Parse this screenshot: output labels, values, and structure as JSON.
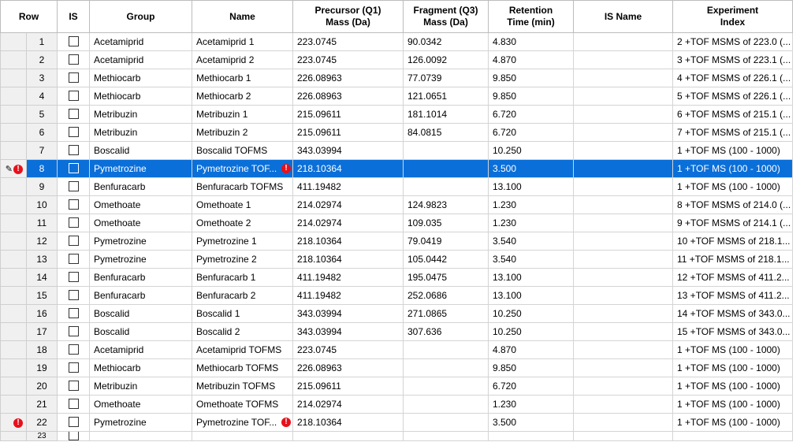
{
  "columns": {
    "row": "Row",
    "is": "IS",
    "group": "Group",
    "name": "Name",
    "precursor_l1": "Precursor (Q1)",
    "precursor_l2": "Mass (Da)",
    "fragment_l1": "Fragment (Q3)",
    "fragment_l2": "Mass (Da)",
    "retention_l1": "Retention",
    "retention_l2": "Time (min)",
    "is_name": "IS Name",
    "experiment_l1": "Experiment",
    "experiment_l2": "Index"
  },
  "rows": [
    {
      "row": "1",
      "group": "Acetamiprid",
      "name": "Acetamiprid 1",
      "precursor": "223.0745",
      "fragment": "90.0342",
      "retention": "4.830",
      "is_name": "",
      "experiment": "2 +TOF MSMS of 223.0 (..."
    },
    {
      "row": "2",
      "group": "Acetamiprid",
      "name": "Acetamiprid 2",
      "precursor": "223.0745",
      "fragment": "126.0092",
      "retention": "4.870",
      "is_name": "",
      "experiment": "3 +TOF MSMS of 223.1 (..."
    },
    {
      "row": "3",
      "group": "Methiocarb",
      "name": "Methiocarb 1",
      "precursor": "226.08963",
      "fragment": "77.0739",
      "retention": "9.850",
      "is_name": "",
      "experiment": "4 +TOF MSMS of 226.1 (..."
    },
    {
      "row": "4",
      "group": "Methiocarb",
      "name": "Methiocarb 2",
      "precursor": "226.08963",
      "fragment": "121.0651",
      "retention": "9.850",
      "is_name": "",
      "experiment": "5 +TOF MSMS of 226.1 (..."
    },
    {
      "row": "5",
      "group": "Metribuzin",
      "name": "Metribuzin 1",
      "precursor": "215.09611",
      "fragment": "181.1014",
      "retention": "6.720",
      "is_name": "",
      "experiment": "6 +TOF MSMS of 215.1 (..."
    },
    {
      "row": "6",
      "group": "Metribuzin",
      "name": "Metribuzin 2",
      "precursor": "215.09611",
      "fragment": "84.0815",
      "retention": "6.720",
      "is_name": "",
      "experiment": "7 +TOF MSMS of 215.1 (..."
    },
    {
      "row": "7",
      "group": "Boscalid",
      "name": "Boscalid TOFMS",
      "precursor": "343.03994",
      "fragment": "",
      "retention": "10.250",
      "is_name": "",
      "experiment": "1 +TOF MS (100 - 1000)"
    },
    {
      "row": "8",
      "group": "Pymetrozine",
      "name": "Pymetrozine  TOF...",
      "precursor": "218.10364",
      "fragment": "",
      "retention": "3.500",
      "is_name": "",
      "experiment": "1 +TOF MS (100 - 1000)"
    },
    {
      "row": "9",
      "group": "Benfuracarb",
      "name": "Benfuracarb TOFMS",
      "precursor": "411.19482",
      "fragment": "",
      "retention": "13.100",
      "is_name": "",
      "experiment": "1 +TOF MS (100 - 1000)"
    },
    {
      "row": "10",
      "group": "Omethoate",
      "name": "Omethoate 1",
      "precursor": "214.02974",
      "fragment": "124.9823",
      "retention": "1.230",
      "is_name": "",
      "experiment": "8 +TOF MSMS of 214.0 (..."
    },
    {
      "row": "11",
      "group": "Omethoate",
      "name": "Omethoate 2",
      "precursor": "214.02974",
      "fragment": "109.035",
      "retention": "1.230",
      "is_name": "",
      "experiment": "9 +TOF MSMS of 214.1 (..."
    },
    {
      "row": "12",
      "group": "Pymetrozine",
      "name": "Pymetrozine 1",
      "precursor": "218.10364",
      "fragment": "79.0419",
      "retention": "3.540",
      "is_name": "",
      "experiment": "10 +TOF MSMS of 218.1..."
    },
    {
      "row": "13",
      "group": "Pymetrozine",
      "name": "Pymetrozine 2",
      "precursor": "218.10364",
      "fragment": "105.0442",
      "retention": "3.540",
      "is_name": "",
      "experiment": "11 +TOF MSMS of 218.1..."
    },
    {
      "row": "14",
      "group": "Benfuracarb",
      "name": "Benfuracarb 1",
      "precursor": "411.19482",
      "fragment": "195.0475",
      "retention": "13.100",
      "is_name": "",
      "experiment": "12 +TOF MSMS of 411.2..."
    },
    {
      "row": "15",
      "group": "Benfuracarb",
      "name": "Benfuracarb 2",
      "precursor": "411.19482",
      "fragment": "252.0686",
      "retention": "13.100",
      "is_name": "",
      "experiment": "13 +TOF MSMS of 411.2..."
    },
    {
      "row": "16",
      "group": "Boscalid",
      "name": "Boscalid 1",
      "precursor": "343.03994",
      "fragment": "271.0865",
      "retention": "10.250",
      "is_name": "",
      "experiment": "14 +TOF MSMS of 343.0..."
    },
    {
      "row": "17",
      "group": "Boscalid",
      "name": "Boscalid 2",
      "precursor": "343.03994",
      "fragment": "307.636",
      "retention": "10.250",
      "is_name": "",
      "experiment": "15 +TOF MSMS of 343.0..."
    },
    {
      "row": "18",
      "group": "Acetamiprid",
      "name": "Acetamiprid TOFMS",
      "precursor": "223.0745",
      "fragment": "",
      "retention": "4.870",
      "is_name": "",
      "experiment": "1 +TOF MS (100 - 1000)"
    },
    {
      "row": "19",
      "group": "Methiocarb",
      "name": "Methiocarb TOFMS",
      "precursor": "226.08963",
      "fragment": "",
      "retention": "9.850",
      "is_name": "",
      "experiment": "1 +TOF MS (100 - 1000)"
    },
    {
      "row": "20",
      "group": "Metribuzin",
      "name": "Metribuzin TOFMS",
      "precursor": "215.09611",
      "fragment": "",
      "retention": "6.720",
      "is_name": "",
      "experiment": "1 +TOF MS (100 - 1000)"
    },
    {
      "row": "21",
      "group": "Omethoate",
      "name": "Omethoate TOFMS",
      "precursor": "214.02974",
      "fragment": "",
      "retention": "1.230",
      "is_name": "",
      "experiment": "1 +TOF MS (100 - 1000)"
    },
    {
      "row": "22",
      "group": "Pymetrozine",
      "name": "Pymetrozine  TOF...",
      "precursor": "218.10364",
      "fragment": "",
      "retention": "3.500",
      "is_name": "",
      "experiment": "1 +TOF MS (100 - 1000)"
    }
  ],
  "partial_row": {
    "row": "23"
  },
  "colors": {
    "selection": "#0a6fd9",
    "error": "#e8101b"
  },
  "icons": {
    "error": "exclamation-circle-icon",
    "edit": "pencil-icon"
  }
}
